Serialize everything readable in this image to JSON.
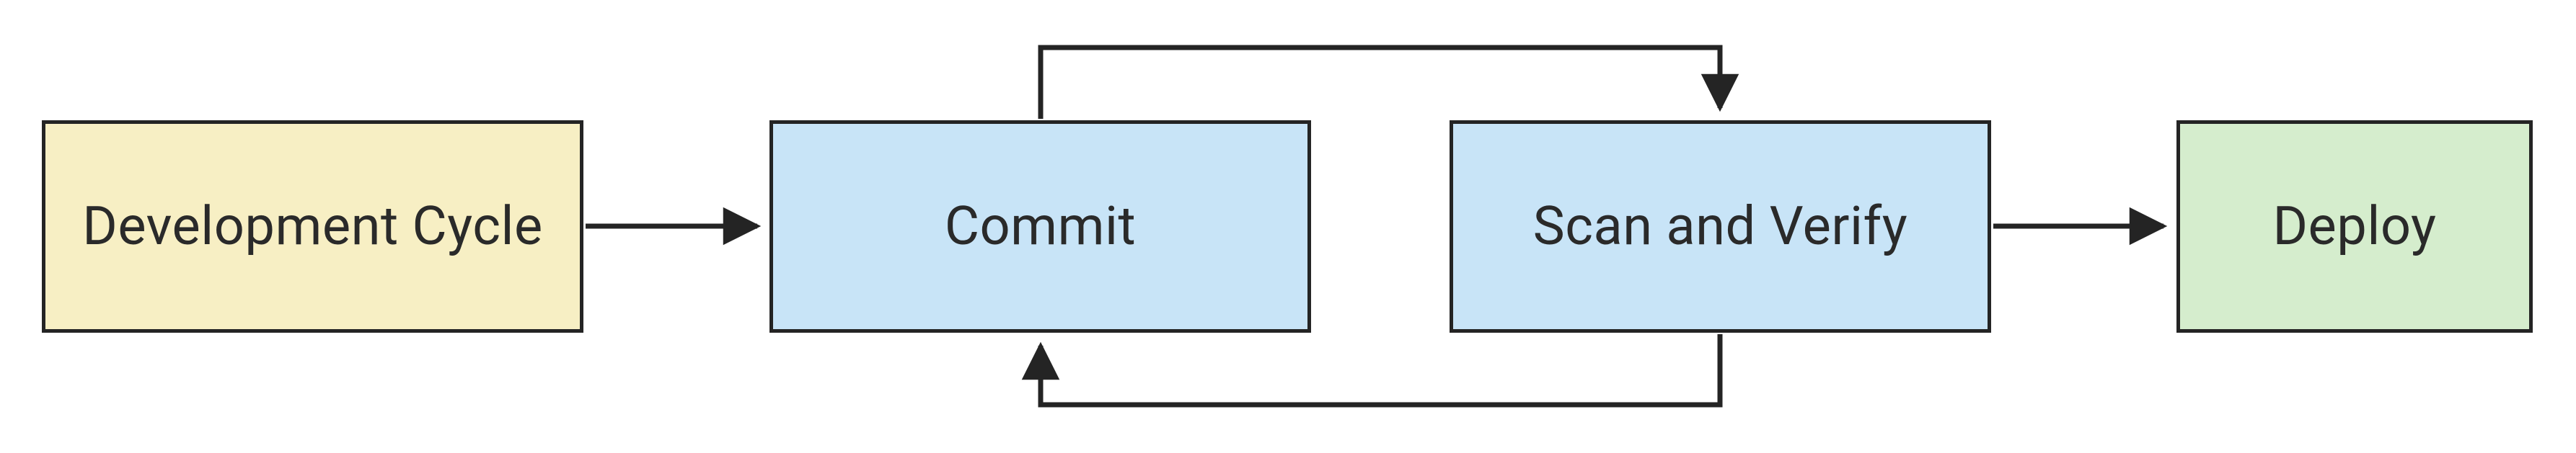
{
  "boxes": {
    "dev": {
      "label": "Development Cycle"
    },
    "commit": {
      "label": "Commit"
    },
    "scan": {
      "label": "Scan and Verify"
    },
    "deploy": {
      "label": "Deploy"
    }
  },
  "colors": {
    "yellow": "#f7efc4",
    "blue": "#c8e4f7",
    "green": "#d5edcd",
    "stroke": "#242424"
  },
  "diagram": {
    "type": "flowchart",
    "nodes": [
      "Development Cycle",
      "Commit",
      "Scan and Verify",
      "Deploy"
    ],
    "edges": [
      {
        "from": "Development Cycle",
        "to": "Commit"
      },
      {
        "from": "Commit",
        "to": "Scan and Verify",
        "bidirectional": true
      },
      {
        "from": "Scan and Verify",
        "to": "Deploy"
      }
    ]
  }
}
